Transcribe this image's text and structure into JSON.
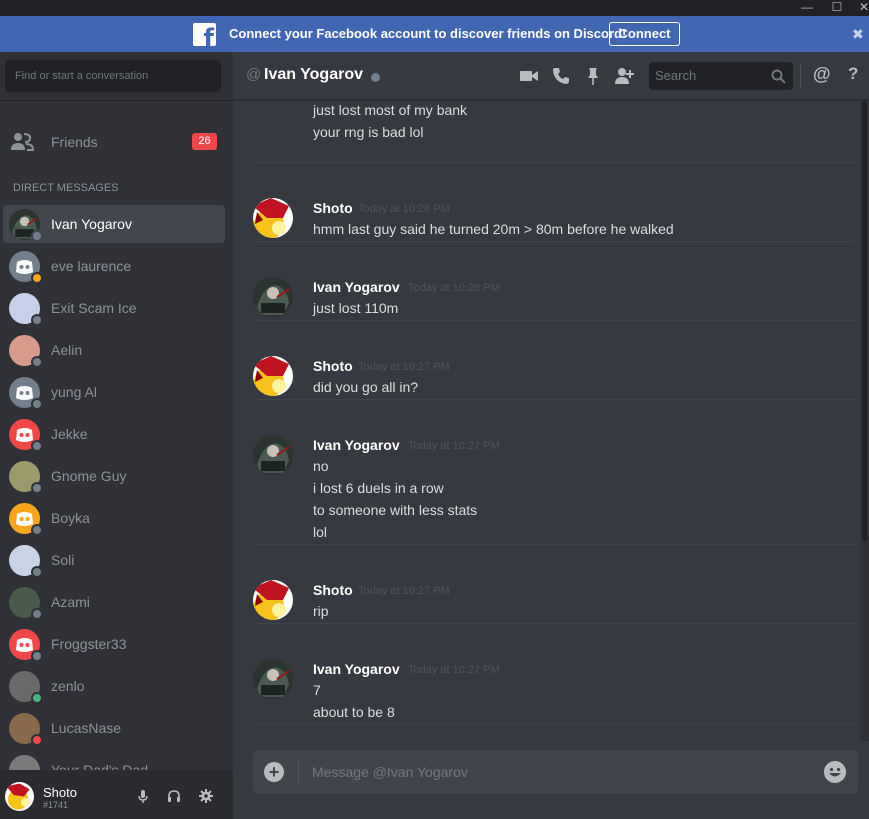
{
  "banner": {
    "text": "Connect your Facebook account to discover friends on Discord!",
    "button": "Connect",
    "close": "✖"
  },
  "sidebar": {
    "search_placeholder": "Find or start a conversation",
    "friends_label": "Friends",
    "friends_badge": "26",
    "dm_header": "DIRECT MESSAGES",
    "dms": [
      {
        "name": "Ivan Yogarov",
        "status": "#747f8d",
        "avatar": "#3b4a3f",
        "active": true
      },
      {
        "name": "eve laurence",
        "status": "#faa61a",
        "avatar": "#747f8d"
      },
      {
        "name": "Exit Scam Ice",
        "status": "#747f8d",
        "avatar": "#c8cfe8"
      },
      {
        "name": "Aelin",
        "status": "#747f8d",
        "avatar": "#d89a8a"
      },
      {
        "name": "yung Al",
        "status": "#747f8d",
        "avatar": "#747f8d"
      },
      {
        "name": "Jekke",
        "status": "#747f8d",
        "avatar": "#f04747"
      },
      {
        "name": "Gnome Guy",
        "status": "#747f8d",
        "avatar": "#9a9a6a"
      },
      {
        "name": "Boyka",
        "status": "#747f8d",
        "avatar": "#faa61a"
      },
      {
        "name": "Soli",
        "status": "#747f8d",
        "avatar": "#c9d3e8"
      },
      {
        "name": "Azami",
        "status": "#747f8d",
        "avatar": "#4a5a4a"
      },
      {
        "name": "Froggster33",
        "status": "#747f8d",
        "avatar": "#f04747"
      },
      {
        "name": "zenlo",
        "status": "#43b581",
        "avatar": "#6a6a6a"
      },
      {
        "name": "LucasNase",
        "status": "#f04747",
        "avatar": "#8a6a4a"
      },
      {
        "name": "Your Dad's Dad",
        "status": "#747f8d",
        "avatar": "#7a7a7a"
      }
    ]
  },
  "user": {
    "name": "Shoto",
    "tag": "#1741"
  },
  "header": {
    "at": "@",
    "name": "Ivan Yogarov",
    "search_placeholder": "Search",
    "mentions": "@",
    "help": "?"
  },
  "messages": [
    {
      "author": "",
      "time": "",
      "avatar": "",
      "lines": [
        "just lost most of my bank",
        "your rng is bad lol"
      ]
    },
    {
      "author": "Shoto",
      "time": "Today at 10:26 PM",
      "avatar": "shoto",
      "lines": [
        "hmm last guy said he turned 20m > 80m before he walked"
      ]
    },
    {
      "author": "Ivan Yogarov",
      "time": "Today at 10:26 PM",
      "avatar": "ivan",
      "lines": [
        "just lost 110m"
      ]
    },
    {
      "author": "Shoto",
      "time": "Today at 10:27 PM",
      "avatar": "shoto",
      "lines": [
        "did you go all in?"
      ]
    },
    {
      "author": "Ivan Yogarov",
      "time": "Today at 10:27 PM",
      "avatar": "ivan",
      "lines": [
        "no",
        "i lost 6 duels in a row",
        "to someone with less stats",
        "lol"
      ]
    },
    {
      "author": "Shoto",
      "time": "Today at 10:27 PM",
      "avatar": "shoto",
      "lines": [
        "rip"
      ]
    },
    {
      "author": "Ivan Yogarov",
      "time": "Today at 10:27 PM",
      "avatar": "ivan",
      "lines": [
        "7",
        "about to be 8"
      ]
    }
  ],
  "composer": {
    "placeholder": "Message @Ivan Yogarov"
  },
  "colors": {
    "accent": "#7289da",
    "banner": "#4267b2",
    "badge": "#f04747"
  }
}
